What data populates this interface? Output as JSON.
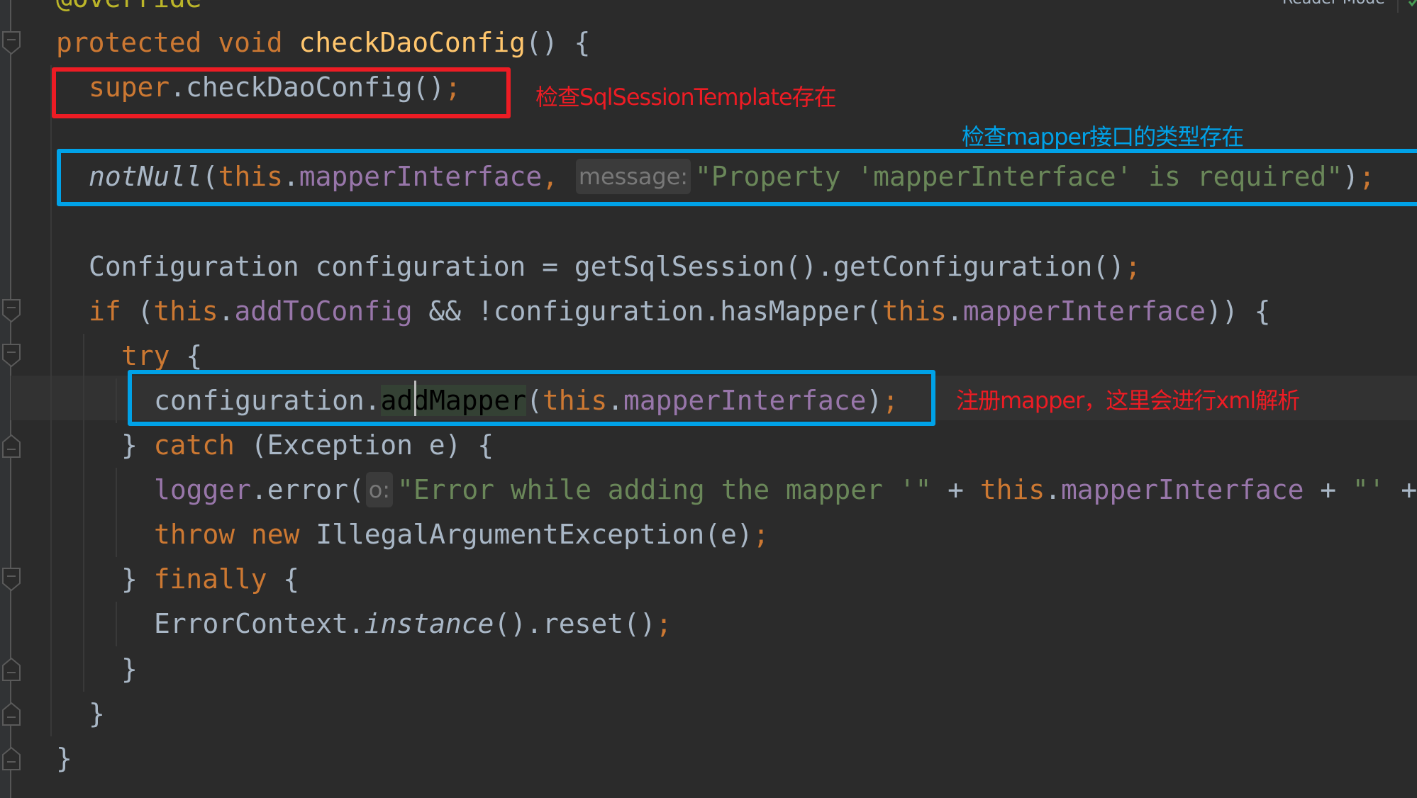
{
  "editor": {
    "reader_mode_label": "Reader Mode",
    "icons": {
      "fold_open": "fold-collapse-icon",
      "fold_end": "fold-end-icon",
      "inspection_ok": "check-icon"
    },
    "colors": {
      "background": "#2b2b2b",
      "caret_row": "#323232",
      "keyword": "#cc7832",
      "annotation": "#bbb529",
      "method_declaration": "#ffc66d",
      "plain": "#a9b7c6",
      "field": "#9876aa",
      "string": "#6a8759"
    },
    "lines": [
      {
        "indent": 0,
        "tokens": [
          {
            "t": "@Override",
            "k": "annotation"
          }
        ]
      },
      {
        "indent": 0,
        "fold": "open",
        "tokens": [
          {
            "t": "protected void ",
            "k": "keyword"
          },
          {
            "t": "checkDaoConfig",
            "k": "method-decl"
          },
          {
            "t": "() {",
            "k": "plain"
          }
        ]
      },
      {
        "indent": 1,
        "tokens": [
          {
            "t": "super",
            "k": "keyword"
          },
          {
            "t": ".checkDaoConfig()",
            "k": "plain"
          },
          {
            "t": ";",
            "k": "semicolon"
          }
        ]
      },
      {
        "indent": 1,
        "tokens": []
      },
      {
        "indent": 1,
        "tokens": [
          {
            "t": "notNull",
            "k": "italic"
          },
          {
            "t": "(",
            "k": "plain"
          },
          {
            "t": "this",
            "k": "keyword"
          },
          {
            "t": ".",
            "k": "plain"
          },
          {
            "t": "mapperInterface",
            "k": "field"
          },
          {
            "t": ", ",
            "k": "semicolon"
          },
          {
            "t": "message:",
            "k": "hint"
          },
          {
            "t": "\"Property 'mapperInterface' is required\"",
            "k": "string"
          },
          {
            "t": ")",
            "k": "plain"
          },
          {
            "t": ";",
            "k": "semicolon"
          }
        ]
      },
      {
        "indent": 1,
        "tokens": []
      },
      {
        "indent": 1,
        "tokens": [
          {
            "t": "Configuration configuration = getSqlSession().getConfiguration()",
            "k": "plain"
          },
          {
            "t": ";",
            "k": "semicolon"
          }
        ]
      },
      {
        "indent": 1,
        "fold": "open",
        "tokens": [
          {
            "t": "if ",
            "k": "keyword"
          },
          {
            "t": "(",
            "k": "plain"
          },
          {
            "t": "this",
            "k": "keyword"
          },
          {
            "t": ".",
            "k": "plain"
          },
          {
            "t": "addToConfig",
            "k": "field"
          },
          {
            "t": " && !configuration.hasMapper(",
            "k": "plain"
          },
          {
            "t": "this",
            "k": "keyword"
          },
          {
            "t": ".",
            "k": "plain"
          },
          {
            "t": "mapperInterface",
            "k": "field"
          },
          {
            "t": ")) {",
            "k": "plain"
          }
        ]
      },
      {
        "indent": 2,
        "fold": "open",
        "tokens": [
          {
            "t": "try ",
            "k": "keyword"
          },
          {
            "t": "{",
            "k": "plain"
          }
        ]
      },
      {
        "indent": 3,
        "caret": true,
        "tokens": [
          {
            "t": "configuration.",
            "k": "plain"
          },
          {
            "t": "addMapper",
            "k": "usage"
          },
          {
            "t": "(",
            "k": "plain"
          },
          {
            "t": "this",
            "k": "keyword"
          },
          {
            "t": ".",
            "k": "plain"
          },
          {
            "t": "mapperInterface",
            "k": "field"
          },
          {
            "t": ")",
            "k": "plain"
          },
          {
            "t": ";",
            "k": "semicolon"
          }
        ]
      },
      {
        "indent": 2,
        "fold": "end",
        "tokens": [
          {
            "t": "} ",
            "k": "plain"
          },
          {
            "t": "catch ",
            "k": "keyword"
          },
          {
            "t": "(Exception e) {",
            "k": "plain"
          }
        ]
      },
      {
        "indent": 3,
        "tokens": [
          {
            "t": "logger",
            "k": "field"
          },
          {
            "t": ".error(",
            "k": "plain"
          },
          {
            "t": "o:",
            "k": "hint"
          },
          {
            "t": "\"Error while adding the mapper '\"",
            "k": "string"
          },
          {
            "t": " + ",
            "k": "plain"
          },
          {
            "t": "this",
            "k": "keyword"
          },
          {
            "t": ".",
            "k": "plain"
          },
          {
            "t": "mapperInterface",
            "k": "field"
          },
          {
            "t": " + ",
            "k": "plain"
          },
          {
            "t": "\"' ",
            "k": "string"
          },
          {
            "t": "+",
            "k": "plain"
          }
        ]
      },
      {
        "indent": 3,
        "tokens": [
          {
            "t": "throw new ",
            "k": "keyword"
          },
          {
            "t": "IllegalArgumentException(e)",
            "k": "plain"
          },
          {
            "t": ";",
            "k": "semicolon"
          }
        ]
      },
      {
        "indent": 2,
        "fold": "open",
        "tokens": [
          {
            "t": "} ",
            "k": "plain"
          },
          {
            "t": "finally ",
            "k": "keyword"
          },
          {
            "t": "{",
            "k": "plain"
          }
        ]
      },
      {
        "indent": 3,
        "tokens": [
          {
            "t": "ErrorContext.",
            "k": "plain"
          },
          {
            "t": "instance",
            "k": "italic"
          },
          {
            "t": "().reset()",
            "k": "plain"
          },
          {
            "t": ";",
            "k": "semicolon"
          }
        ]
      },
      {
        "indent": 2,
        "fold": "end",
        "tokens": [
          {
            "t": "}",
            "k": "plain"
          }
        ]
      },
      {
        "indent": 1,
        "fold": "end",
        "tokens": [
          {
            "t": "}",
            "k": "plain"
          }
        ]
      },
      {
        "indent": 0,
        "fold": "end",
        "tokens": [
          {
            "t": "}",
            "k": "plain"
          }
        ]
      }
    ]
  },
  "annotations": [
    {
      "text": "检查SqlSessionTemplate存在",
      "color": "#ed1c24"
    },
    {
      "text": "检查mapper接口的类型存在",
      "color": "#00a2e8"
    },
    {
      "text": "注册mapper，这里会进行xml解析",
      "color": "#ed1c24"
    }
  ]
}
